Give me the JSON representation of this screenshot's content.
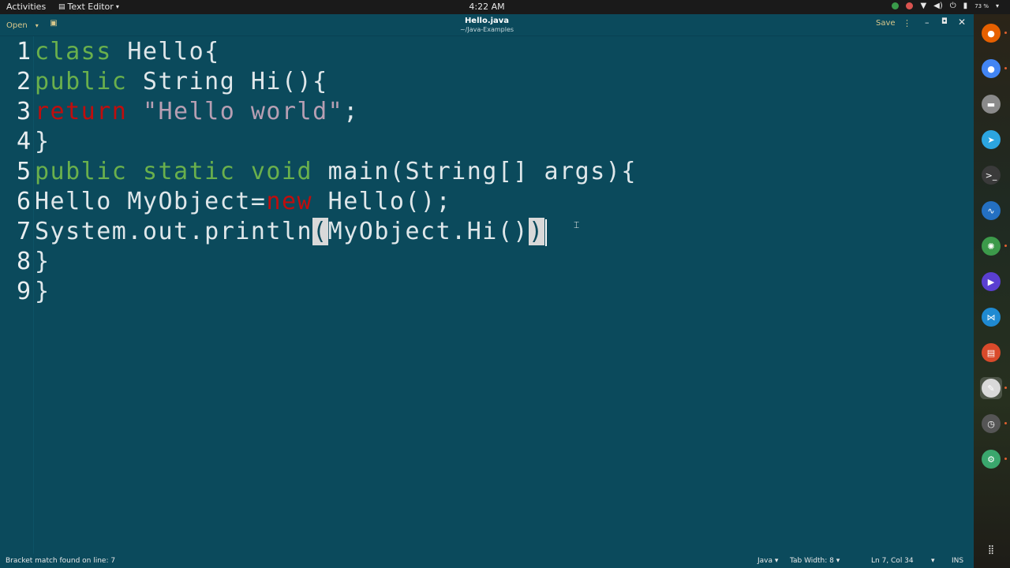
{
  "topbar": {
    "activities": "Activities",
    "app_name": "Text Editor",
    "clock": "4:22 AM",
    "battery": "73 %"
  },
  "headerbar": {
    "open_label": "Open",
    "title": "Hello.java",
    "subtitle": "~/Java-Examples",
    "save_label": "Save"
  },
  "editor": {
    "line_numbers": [
      "1",
      "2",
      "3",
      "4",
      "5",
      "6",
      "7",
      "8",
      "9"
    ],
    "lines": [
      [
        {
          "text": "class",
          "kind": "green"
        },
        {
          "text": " Hello{"
        }
      ],
      [
        {
          "text": "public",
          "kind": "green"
        },
        {
          "text": " String Hi(){"
        }
      ],
      [
        {
          "text": "return",
          "kind": "red"
        },
        {
          "text": " "
        },
        {
          "text": "\"Hello world\"",
          "kind": "str"
        },
        {
          "text": ";"
        }
      ],
      [
        {
          "text": "}"
        }
      ],
      [
        {
          "text": "public",
          "kind": "green"
        },
        {
          "text": " "
        },
        {
          "text": "static",
          "kind": "green"
        },
        {
          "text": " "
        },
        {
          "text": "void",
          "kind": "green"
        },
        {
          "text": " main(String[] args){"
        }
      ],
      [
        {
          "text": "Hello MyObject="
        },
        {
          "text": "new",
          "kind": "red"
        },
        {
          "text": " Hello();"
        }
      ],
      [
        {
          "text": "System.out.println"
        },
        {
          "text": "(",
          "kind": "hl"
        },
        {
          "text": "MyObject.Hi()"
        },
        {
          "text": ")",
          "kind": "hl"
        },
        {
          "text": "",
          "kind": "caret"
        }
      ],
      [
        {
          "text": "}"
        }
      ],
      [
        {
          "text": "}"
        }
      ]
    ]
  },
  "statusbar": {
    "message": "Bracket match found on line: 7",
    "language": "Java",
    "tab_width": "Tab Width: 8",
    "position": "Ln 7, Col 34",
    "insert_mode": "INS"
  },
  "dock": {
    "items": [
      {
        "name": "firefox-icon",
        "color": "#e66000",
        "glyph": "●",
        "running": true
      },
      {
        "name": "chrome-icon",
        "color": "#4285f4",
        "glyph": "●",
        "running": true
      },
      {
        "name": "files-icon",
        "color": "#8a8a8a",
        "glyph": "▬",
        "running": false
      },
      {
        "name": "telegram-icon",
        "color": "#2ca5e0",
        "glyph": "➤",
        "running": false
      },
      {
        "name": "terminal-icon",
        "color": "#3a3a3a",
        "glyph": ">_",
        "running": false
      },
      {
        "name": "system-monitor-icon",
        "color": "#2470c2",
        "glyph": "∿",
        "running": false
      },
      {
        "name": "atom-icon",
        "color": "#3c9a4a",
        "glyph": "✺",
        "running": true
      },
      {
        "name": "media-player-icon",
        "color": "#5a3fd1",
        "glyph": "▶",
        "running": false
      },
      {
        "name": "vscode-icon",
        "color": "#1f8ad2",
        "glyph": "⋈",
        "running": false
      },
      {
        "name": "document-viewer-icon",
        "color": "#d94a2b",
        "glyph": "▤",
        "running": false
      },
      {
        "name": "text-editor-icon",
        "color": "#d9d9d9",
        "glyph": "✎",
        "running": true,
        "active": true
      },
      {
        "name": "timeshift-icon",
        "color": "#555555",
        "glyph": "◷",
        "running": true
      },
      {
        "name": "android-studio-icon",
        "color": "#3aa76d",
        "glyph": "⚙",
        "running": true
      },
      {
        "name": "show-apps-icon",
        "color": "transparent",
        "glyph": "⣿",
        "running": false
      }
    ]
  }
}
